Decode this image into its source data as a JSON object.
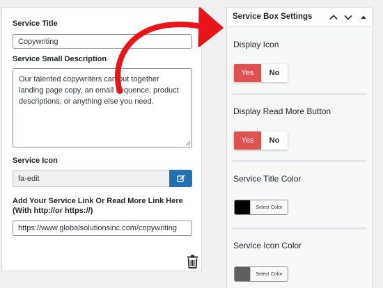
{
  "form": {
    "service_title_label": "Service Title",
    "service_title_value": "Copywriting",
    "description_label": "Service Small Description",
    "description_value": "Our talented copywriters can put together landing page copy, an email sequence, product descriptions, or anything else you need.",
    "icon_label": "Service Icon",
    "icon_value": "fa-edit",
    "link_label": "Add Your Service Link Or Read More Link Here (With http://or https://)",
    "link_value": "https://www.globalsolutionsinc.com/copywriting"
  },
  "settings_panel": {
    "title": "Service Box Settings",
    "display_icon": {
      "label": "Display Icon",
      "yes": "Yes",
      "no": "No",
      "selected": "Yes"
    },
    "display_read_more": {
      "label": "Display Read More Button",
      "yes": "Yes",
      "no": "No",
      "selected": "Yes"
    },
    "title_color": {
      "label": "Service Title Color",
      "button": "Select Color",
      "color": "#000000"
    },
    "icon_color": {
      "label": "Service Icon Color",
      "button": "Select Color",
      "color": "#5f5f5f"
    }
  },
  "colors": {
    "toggle_active": "#e05252",
    "edit_button": "#2271b1",
    "arrow": "#e8151b"
  }
}
